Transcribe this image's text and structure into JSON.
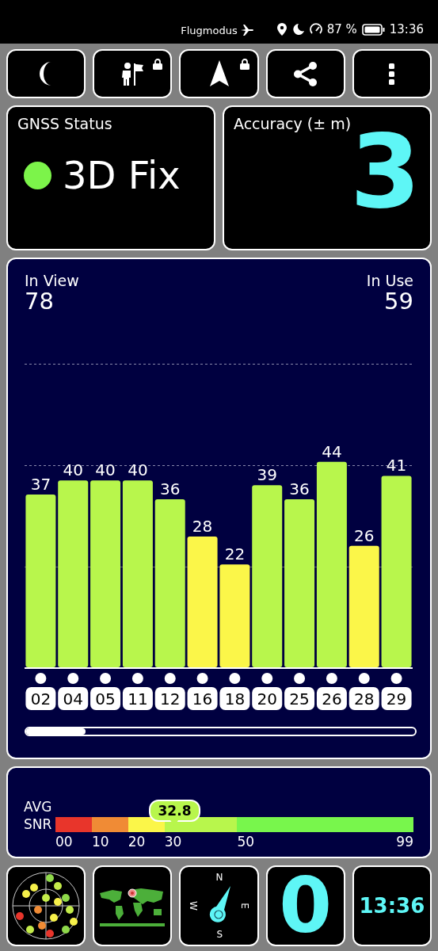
{
  "status_bar": {
    "airplane_mode_label": "Flugmodus",
    "battery_percent": "87 %",
    "time": "13:36"
  },
  "toolbar_buttons": [
    {
      "kind": "night_mode",
      "locked": false
    },
    {
      "kind": "person_flag",
      "locked": true
    },
    {
      "kind": "navigation",
      "locked": true
    },
    {
      "kind": "share",
      "locked": false
    },
    {
      "kind": "more",
      "locked": false
    }
  ],
  "gnss_status": {
    "title": "GNSS Status",
    "value": "3D Fix"
  },
  "accuracy": {
    "title": "Accuracy (± m)",
    "value": "3"
  },
  "satellites": {
    "in_view_label": "In View",
    "in_view": "78",
    "in_use_label": "In Use",
    "in_use": "59",
    "chart_data": {
      "type": "bar",
      "categories": [
        "02",
        "04",
        "05",
        "11",
        "12",
        "16",
        "18",
        "20",
        "25",
        "26",
        "28",
        "29"
      ],
      "values": [
        37,
        40,
        40,
        40,
        36,
        28,
        22,
        39,
        36,
        44,
        26,
        41
      ],
      "data_labels": true
    }
  },
  "snr": {
    "label": "AVG SNR",
    "average": "32.8",
    "end_label": "99",
    "segments": [
      {
        "label": "00",
        "color": "#e8352b"
      },
      {
        "label": "10",
        "color": "#f08b35"
      },
      {
        "label": "20",
        "color": "#fbf649"
      },
      {
        "label": "30",
        "color": "#b8f64c"
      },
      {
        "label": "50",
        "color": "#78f64c"
      }
    ]
  },
  "bottom_tiles": [
    {
      "kind": "sky_plot"
    },
    {
      "kind": "world_map"
    },
    {
      "kind": "compass",
      "north": "N",
      "east": "E",
      "south": "S",
      "west": "W"
    },
    {
      "kind": "counter",
      "value": "0"
    },
    {
      "kind": "clock",
      "time": "13:36"
    }
  ]
}
